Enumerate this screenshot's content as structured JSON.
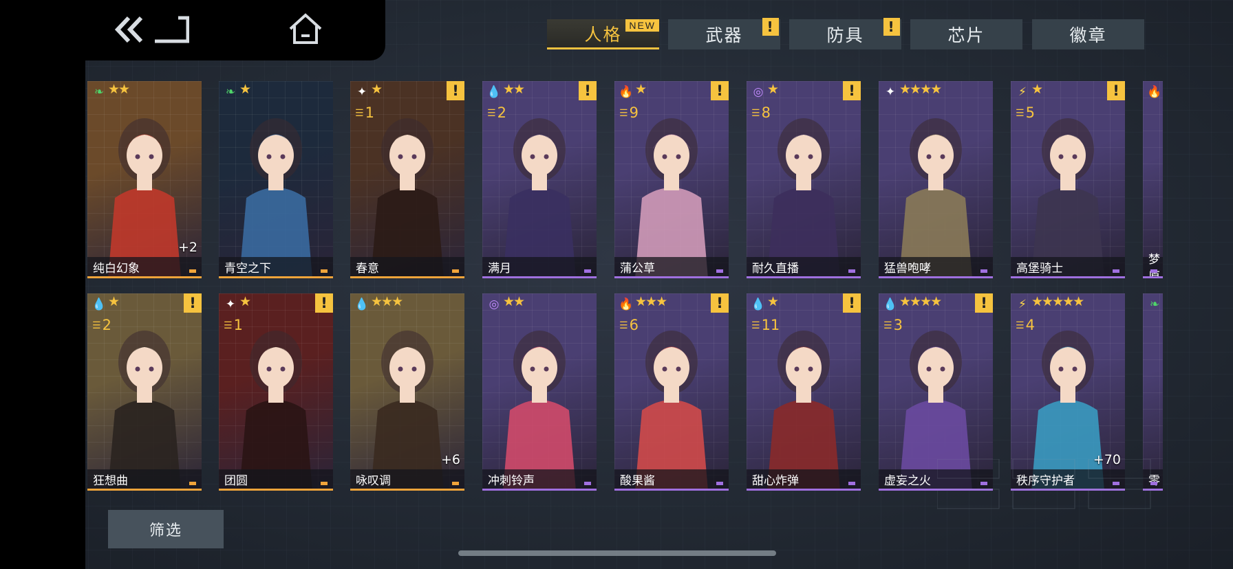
{
  "tabs": [
    {
      "label": "人格",
      "new_badge": "NEW",
      "alert": null,
      "active": true
    },
    {
      "label": "武器",
      "new_badge": null,
      "alert": "!",
      "active": false
    },
    {
      "label": "防具",
      "new_badge": null,
      "alert": "!",
      "active": false
    },
    {
      "label": "芯片",
      "new_badge": null,
      "alert": null,
      "active": false
    },
    {
      "label": "徽章",
      "new_badge": null,
      "alert": null,
      "active": false
    }
  ],
  "nav": {
    "back_icon": "double-chevron-back-icon",
    "home_icon": "home-icon"
  },
  "characters": [
    {
      "name": "纯白幻象",
      "element": "wind",
      "stars": "★★",
      "level": "",
      "plus": "+2",
      "alert": "",
      "rarity": "orange"
    },
    {
      "name": "青空之下",
      "element": "wind",
      "stars": "★",
      "level": "",
      "plus": "",
      "alert": "",
      "rarity": "orange"
    },
    {
      "name": "春意",
      "element": "light",
      "stars": "★",
      "level": "1",
      "plus": "",
      "alert": "!",
      "rarity": "orange"
    },
    {
      "name": "满月",
      "element": "water",
      "stars": "★★",
      "level": "2",
      "plus": "",
      "alert": "!",
      "rarity": "purple"
    },
    {
      "name": "蒲公草",
      "element": "fire",
      "stars": "★",
      "level": "9",
      "plus": "",
      "alert": "!",
      "rarity": "purple"
    },
    {
      "name": "耐久直播",
      "element": "psychic",
      "stars": "★",
      "level": "8",
      "plus": "",
      "alert": "!",
      "rarity": "purple"
    },
    {
      "name": "猛兽咆哮",
      "element": "light",
      "stars": "★★★★",
      "level": "",
      "plus": "",
      "alert": "",
      "rarity": "purple"
    },
    {
      "name": "高堡骑士",
      "element": "thunder",
      "stars": "★",
      "level": "5",
      "plus": "",
      "alert": "!",
      "rarity": "purple"
    },
    {
      "name": "梦原",
      "element": "fire",
      "stars": "",
      "level": "",
      "plus": "",
      "alert": "",
      "rarity": "purple"
    },
    {
      "name": "狂想曲",
      "element": "water",
      "stars": "★",
      "level": "2",
      "plus": "",
      "alert": "!",
      "rarity": "orange"
    },
    {
      "name": "团圆",
      "element": "light",
      "stars": "★",
      "level": "1",
      "plus": "",
      "alert": "!",
      "rarity": "orange"
    },
    {
      "name": "咏叹调",
      "element": "water",
      "stars": "★★★",
      "level": "",
      "plus": "+6",
      "alert": "",
      "rarity": "orange"
    },
    {
      "name": "冲刺铃声",
      "element": "psychic",
      "stars": "★★",
      "level": "",
      "plus": "",
      "alert": "",
      "rarity": "purple"
    },
    {
      "name": "酸果酱",
      "element": "fire",
      "stars": "★★★",
      "level": "6",
      "plus": "",
      "alert": "!",
      "rarity": "purple"
    },
    {
      "name": "甜心炸弹",
      "element": "water",
      "stars": "★",
      "level": "11",
      "plus": "",
      "alert": "!",
      "rarity": "purple"
    },
    {
      "name": "虚妄之火",
      "element": "water",
      "stars": "★★★★",
      "level": "3",
      "plus": "",
      "alert": "!",
      "rarity": "purple"
    },
    {
      "name": "秩序守护者",
      "element": "thunder",
      "stars": "★★★★★",
      "level": "4",
      "plus": "+70",
      "alert": "",
      "rarity": "purple"
    },
    {
      "name": "零",
      "element": "wind",
      "stars": "",
      "level": "",
      "plus": "",
      "alert": "",
      "rarity": "purple"
    }
  ],
  "filter_label": "筛选",
  "colors": {
    "accent": "#f6c33f",
    "orange_rarity": "#f0a43a",
    "purple_rarity": "#a070e0"
  }
}
